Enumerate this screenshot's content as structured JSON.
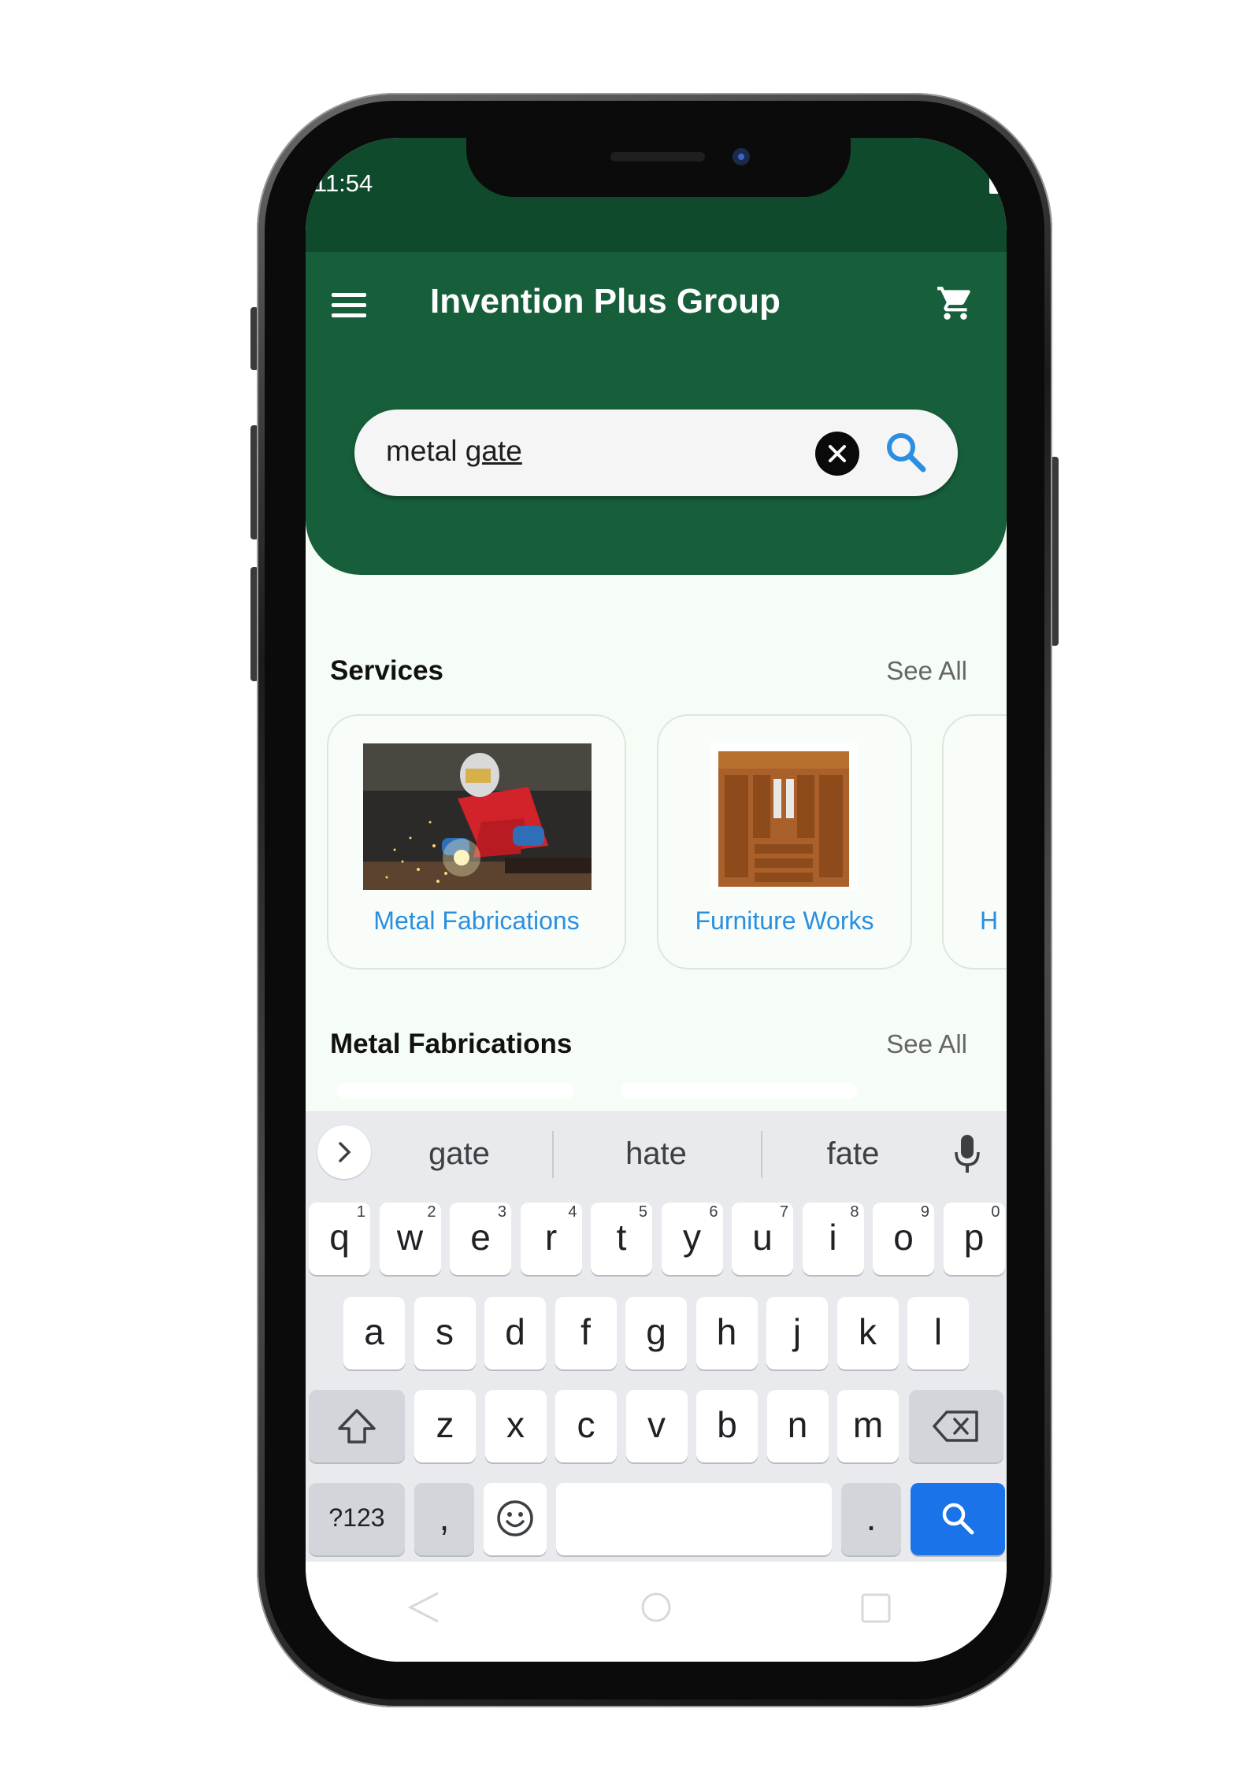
{
  "status_bar": {
    "time": "11:54"
  },
  "app_bar": {
    "title": "Invention Plus Group",
    "menu_icon": "hamburger-menu-icon",
    "cart_icon": "shopping-cart-icon"
  },
  "search": {
    "typed": "metal ",
    "underlined": "gate"
  },
  "services": {
    "heading": "Services",
    "see_all": "See All",
    "cards": [
      {
        "label": "Metal Fabrications",
        "image": "welder-photo"
      },
      {
        "label": "Furniture Works",
        "image": "wardrobe-photo"
      },
      {
        "label": "H",
        "image": ""
      }
    ]
  },
  "metal_fabrications": {
    "heading": "Metal Fabrications",
    "see_all": "See All"
  },
  "keyboard": {
    "suggestions": [
      "gate",
      "hate",
      "fate"
    ],
    "row1": [
      {
        "k": "q",
        "n": "1"
      },
      {
        "k": "w",
        "n": "2"
      },
      {
        "k": "e",
        "n": "3"
      },
      {
        "k": "r",
        "n": "4"
      },
      {
        "k": "t",
        "n": "5"
      },
      {
        "k": "y",
        "n": "6"
      },
      {
        "k": "u",
        "n": "7"
      },
      {
        "k": "i",
        "n": "8"
      },
      {
        "k": "o",
        "n": "9"
      },
      {
        "k": "p",
        "n": "0"
      }
    ],
    "row2": [
      "a",
      "s",
      "d",
      "f",
      "g",
      "h",
      "j",
      "k",
      "l"
    ],
    "row3": [
      "z",
      "x",
      "c",
      "v",
      "b",
      "n",
      "m"
    ],
    "symbols_key": "?123",
    "comma_key": ",",
    "period_key": ".",
    "accent_color": "#1a73e8"
  },
  "colors": {
    "status_bar": "#0f4a2c",
    "app_bar": "#175f3b",
    "link": "#2a8fe0"
  }
}
